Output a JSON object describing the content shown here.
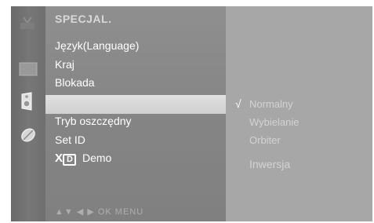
{
  "menu": {
    "title": "SPECJAL.",
    "items": [
      {
        "label": "Język(Language)"
      },
      {
        "label": "Kraj"
      },
      {
        "label": "Blokada"
      },
      {
        "label": ""
      },
      {
        "label": "Tryb oszczędny"
      },
      {
        "label": "Set ID"
      },
      {
        "label": "Demo"
      }
    ],
    "xd_logo": {
      "x": "X",
      "d": "D"
    },
    "hints": "▲▼ ◀ ▶ OK MENU"
  },
  "submenu": {
    "check": "√",
    "options": [
      {
        "label": "Normalny",
        "selected": true
      },
      {
        "label": "Wybielanie"
      },
      {
        "label": "Orbiter"
      },
      {
        "label": "Inwersja"
      }
    ]
  },
  "side_icons": [
    "tv-icon",
    "screen-icon",
    "speaker-icon",
    "satellite-icon"
  ],
  "colors": {
    "panel": "#858585",
    "highlight": "#d8d8d8",
    "submenu": "#a7a7a7",
    "icon_column": "#6f6f6f"
  }
}
